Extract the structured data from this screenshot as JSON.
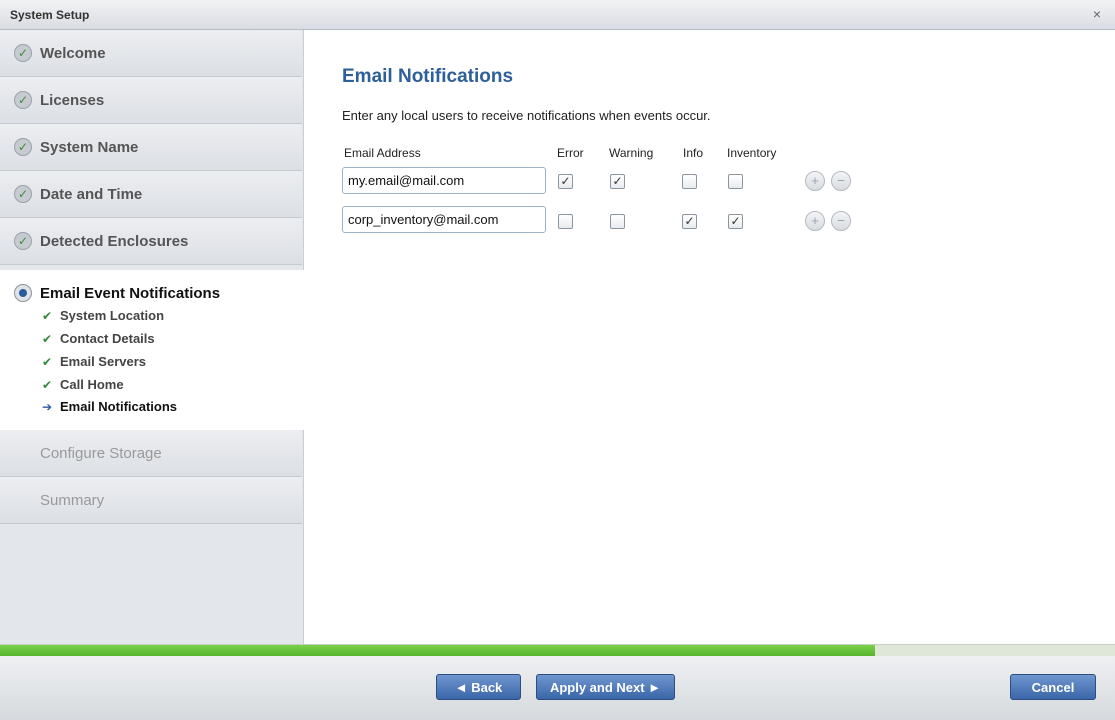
{
  "window": {
    "title": "System Setup",
    "close_icon": "×"
  },
  "sidebar": {
    "completed_steps": [
      {
        "label": "Welcome"
      },
      {
        "label": "Licenses"
      },
      {
        "label": "System Name"
      },
      {
        "label": "Date and Time"
      },
      {
        "label": "Detected Enclosures"
      }
    ],
    "active_step": {
      "label": "Email Event Notifications",
      "substeps": [
        {
          "label": "System Location",
          "state": "done"
        },
        {
          "label": "Contact Details",
          "state": "done"
        },
        {
          "label": "Email Servers",
          "state": "done"
        },
        {
          "label": "Call Home",
          "state": "done"
        },
        {
          "label": "Email Notifications",
          "state": "current"
        }
      ]
    },
    "pending_steps": [
      {
        "label": "Configure Storage"
      },
      {
        "label": "Summary"
      }
    ]
  },
  "main": {
    "heading": "Email Notifications",
    "description": "Enter any local users to receive notifications when events occur.",
    "columns": {
      "email": "Email Address",
      "error": "Error",
      "warning": "Warning",
      "info": "Info",
      "inventory": "Inventory"
    },
    "rows": [
      {
        "email": "my.email@mail.com",
        "error": true,
        "warning": true,
        "info": false,
        "inventory": false
      },
      {
        "email": "corp_inventory@mail.com",
        "error": false,
        "warning": false,
        "info": true,
        "inventory": true
      }
    ]
  },
  "progress": {
    "fraction": 0.785,
    "color": "#5cbf33"
  },
  "footer": {
    "back_label": "◄ Back",
    "apply_next_label": "Apply and Next ►",
    "cancel_label": "Cancel"
  },
  "colors": {
    "accent": "#2d5f9a",
    "button": "#4a75b5"
  }
}
